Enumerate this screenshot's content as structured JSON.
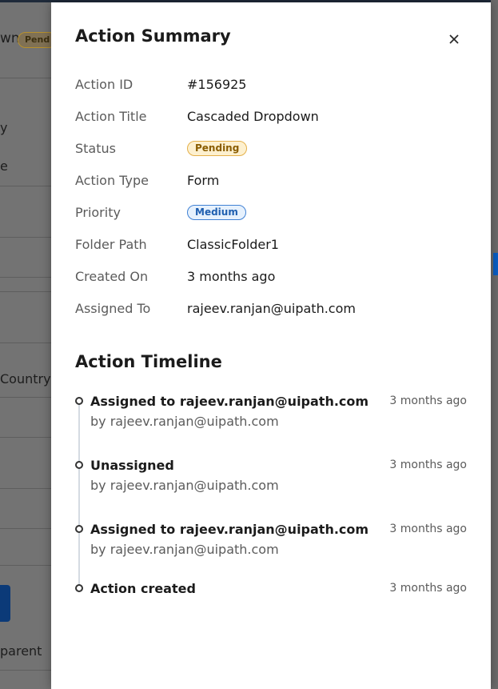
{
  "background": {
    "title_fragment": "wn",
    "status_badge": "Pend",
    "row_fragments": [
      "y",
      "e",
      "Country",
      "parent"
    ]
  },
  "panel": {
    "title": "Action Summary",
    "close_label": "×",
    "fields": [
      {
        "label": "Action ID",
        "value": "#156925"
      },
      {
        "label": "Action Title",
        "value": "Cascaded Dropdown"
      },
      {
        "label": "Status",
        "value": "Pending",
        "badge": "pending"
      },
      {
        "label": "Action Type",
        "value": "Form"
      },
      {
        "label": "Priority",
        "value": "Medium",
        "badge": "medium"
      },
      {
        "label": "Folder Path",
        "value": "ClassicFolder1"
      },
      {
        "label": "Created On",
        "value": "3 months ago"
      },
      {
        "label": "Assigned To",
        "value": "rajeev.ranjan@uipath.com"
      }
    ]
  },
  "timeline": {
    "title": "Action Timeline",
    "items": [
      {
        "title": "Assigned to rajeev.ranjan@uipath.com",
        "by": "by rajeev.ranjan@uipath.com",
        "time": "3 months ago"
      },
      {
        "title": "Unassigned",
        "by": "by rajeev.ranjan@uipath.com",
        "time": "3 months ago"
      },
      {
        "title": "Assigned to rajeev.ranjan@uipath.com",
        "by": "by rajeev.ranjan@uipath.com",
        "time": "3 months ago"
      },
      {
        "title": "Action created",
        "by": "",
        "time": "3 months ago"
      }
    ]
  },
  "colors": {
    "pending_badge": "#fdf0cf",
    "medium_badge": "#e6f1fd",
    "overlay": "#737373"
  }
}
